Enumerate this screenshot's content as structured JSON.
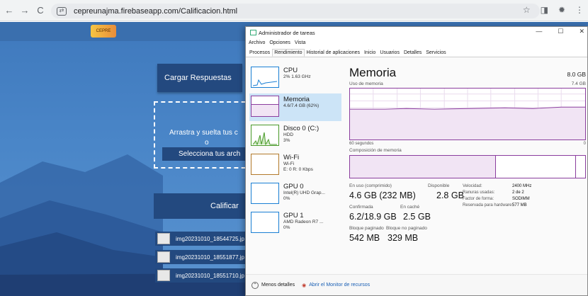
{
  "browser": {
    "url": "cepreunajma.firebaseapp.com/Calificacion.html",
    "back": "←",
    "forward": "→",
    "reload": "C",
    "star": "☆"
  },
  "webpage": {
    "logo_text": "CEPRE",
    "load_button": "Cargar Respuestas",
    "drop_text": "Arrastra y suelta tus c",
    "drop_or": "o",
    "select_button": "Selecciona tus arch",
    "grade_button": "Calificar",
    "files": [
      "img20231010_18544725.jp",
      "img20231010_18551877.jp",
      "img20231010_18551710.jp"
    ]
  },
  "task_manager": {
    "title": "Administrador de tareas",
    "menu": [
      "Archivo",
      "Opciones",
      "Vista"
    ],
    "tabs": [
      "Procesos",
      "Rendimiento",
      "Historial de aplicaciones",
      "Inicio",
      "Usuarios",
      "Detalles",
      "Servicios"
    ],
    "active_tab": "Rendimiento",
    "sidebar": [
      {
        "name": "CPU",
        "sub1": "2% 1.63 GHz",
        "sub2": ""
      },
      {
        "name": "Memoria",
        "sub1": "4.6/7.4 GB (62%)",
        "sub2": ""
      },
      {
        "name": "Disco 0 (C:)",
        "sub1": "HDD",
        "sub2": "3%"
      },
      {
        "name": "Wi-Fi",
        "sub1": "Wi-Fi",
        "sub2": "E: 0 R: 0 Kbps"
      },
      {
        "name": "GPU 0",
        "sub1": "Intel(R) UHD Grap...",
        "sub2": "0%"
      },
      {
        "name": "GPU 1",
        "sub1": "AMD Radeon R7 ...",
        "sub2": "0%"
      }
    ],
    "main": {
      "title": "Memoria",
      "total": "8.0 GB",
      "usage_label": "Uso de memoria",
      "usage_max": "7.4 GB",
      "seconds": "60 segundos",
      "zero": "0",
      "composition_label": "Composición de memoria",
      "in_use_label": "En uso (comprimido)",
      "in_use_value": "4.6 GB (232 MB)",
      "available_label": "Disponible",
      "available_value": "2.8 GB",
      "committed_label": "Confirmada",
      "committed_value": "6.2/18.9 GB",
      "cached_label": "En caché",
      "cached_value": "2.5 GB",
      "paged_label": "Bloque paginado",
      "paged_value": "542 MB",
      "nonpaged_label": "Bloque no paginado",
      "nonpaged_value": "329 MB",
      "speed_label": "Velocidad:",
      "speed_value": "2400 MHz",
      "slots_label": "Ranuras usadas:",
      "slots_value": "2 de 2",
      "form_label": "Factor de forma:",
      "form_value": "SODIMM",
      "reserved_label": "Reservada para hardware:",
      "reserved_value": "577 MB"
    },
    "footer_less": "Menos detalles",
    "footer_monitor": "Abrir el Monitor de recursos"
  }
}
